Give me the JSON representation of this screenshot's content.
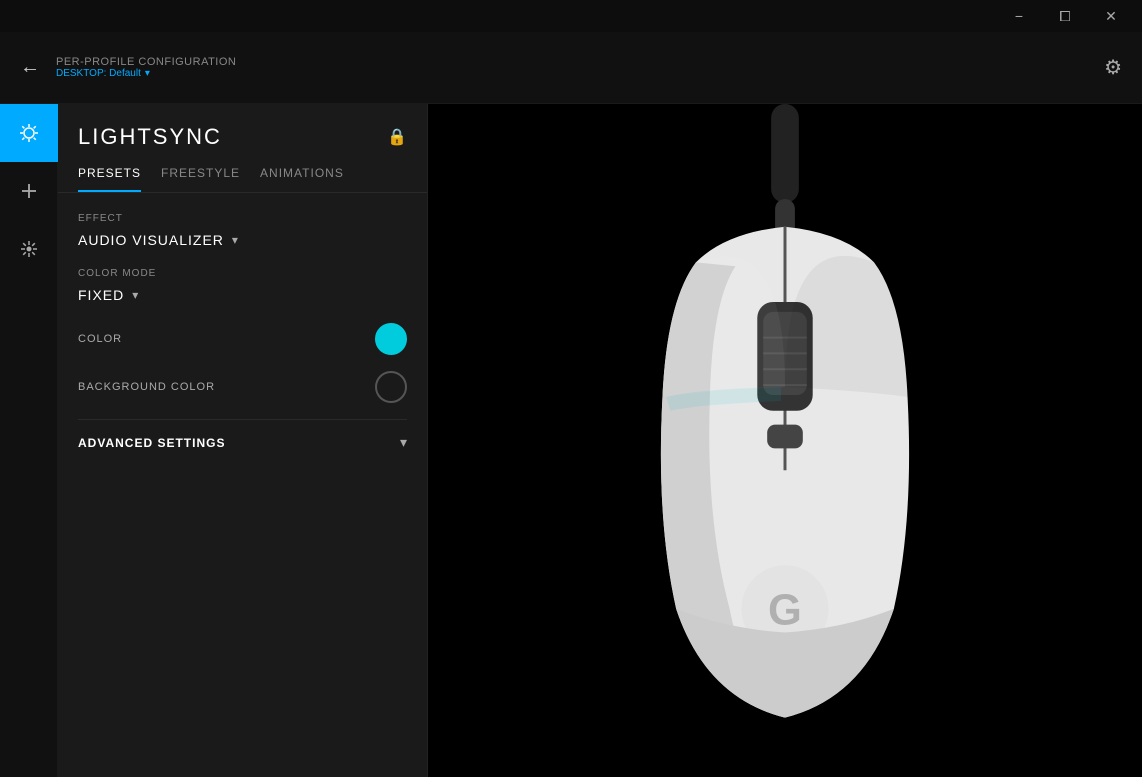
{
  "titleBar": {
    "minimizeLabel": "−",
    "restoreLabel": "⧠",
    "closeLabel": "✕"
  },
  "header": {
    "backArrow": "←",
    "profileLabel": "PER-PROFILE CONFIGURATION",
    "profile": "DESKTOP: Default",
    "profileArrow": "▾",
    "gearIcon": "⚙"
  },
  "sidebar": {
    "items": [
      {
        "name": "lightsync-icon",
        "icon": "✦",
        "active": true
      },
      {
        "name": "add-icon",
        "icon": "+",
        "active": false
      },
      {
        "name": "dpi-icon",
        "icon": "✥",
        "active": false
      }
    ]
  },
  "panel": {
    "title": "LIGHTSYNC",
    "lockIcon": "🔒",
    "tabs": [
      {
        "name": "presets-tab",
        "label": "PRESETS",
        "active": true
      },
      {
        "name": "freestyle-tab",
        "label": "FREESTYLE",
        "active": false
      },
      {
        "name": "animations-tab",
        "label": "ANIMATIONS",
        "active": false
      }
    ],
    "effectLabel": "EFFECT",
    "effectValue": "AUDIO VISUALIZER",
    "effectArrow": "▾",
    "colorModeLabel": "COLOR MODE",
    "colorModeValue": "FIXED",
    "colorModeArrow": "▾",
    "colorLabel": "COLOR",
    "colorValue": "#00ccdd",
    "backgroundColorLabel": "BACKGROUND COLOR",
    "backgroundColorValue": "#1a1a1a",
    "advancedLabel": "ADVANCED SETTINGS",
    "advancedArrow": "▾"
  }
}
